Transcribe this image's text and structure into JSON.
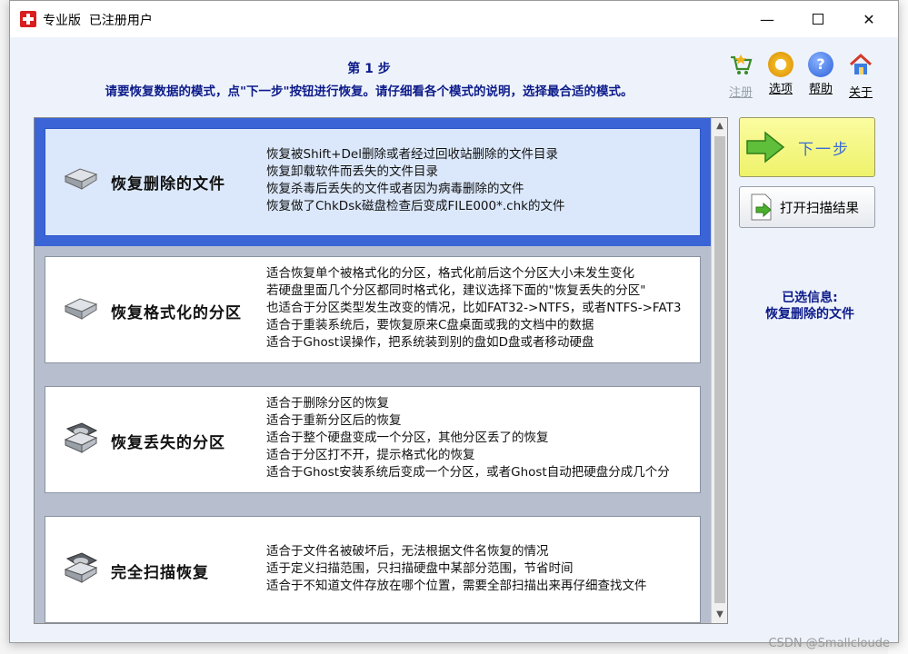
{
  "window": {
    "title": "专业版  已注册用户",
    "minimize": "—",
    "close": "✕"
  },
  "step": {
    "title": "第 1 步",
    "description": "请要恢复数据的模式，点\"下一步\"按钮进行恢复。请仔细看各个模式的说明，选择最合适的模式。"
  },
  "toolbar": {
    "register": "注册",
    "options": "选项",
    "help": "帮助",
    "about": "关于"
  },
  "modes": [
    {
      "name": "恢复删除的文件",
      "selected": true,
      "icon": "hard-disk-icon",
      "lines": [
        "恢复被Shift+Del删除或者经过回收站删除的文件目录",
        "恢复卸载软件而丢失的文件目录",
        "恢复杀毒后丢失的文件或者因为病毒删除的文件",
        "恢复做了ChkDsk磁盘检查后变成FILE000*.chk的文件"
      ]
    },
    {
      "name": "恢复格式化的分区",
      "selected": false,
      "icon": "hard-disk-icon",
      "lines": [
        "适合恢复单个被格式化的分区，格式化前后这个分区大小未发生变化",
        "若硬盘里面几个分区都同时格式化，建议选择下面的\"恢复丢失的分区\"",
        "也适合于分区类型发生改变的情况，比如FAT32->NTFS，或者NTFS->FAT3",
        "适合于重装系统后，要恢复原来C盘桌面或我的文档中的数据",
        "适合于Ghost误操作，把系统装到别的盘如D盘或者移动硬盘"
      ]
    },
    {
      "name": "恢复丢失的分区",
      "selected": false,
      "icon": "open-hard-disk-icon",
      "lines": [
        "适合于删除分区的恢复",
        "适合于重新分区后的恢复",
        "适合于整个硬盘变成一个分区，其他分区丢了的恢复",
        "适合于分区打不开，提示格式化的恢复",
        "适合于Ghost安装系统后变成一个分区，或者Ghost自动把硬盘分成几个分"
      ]
    },
    {
      "name": "完全扫描恢复",
      "selected": false,
      "icon": "open-hard-disk-icon",
      "lines": [
        "适合于文件名被破坏后，无法根据文件名恢复的情况",
        "适于定义扫描范围，只扫描硬盘中某部分范围，节省时间",
        "适合于不知道文件存放在哪个位置，需要全部扫描出来再仔细查找文件"
      ]
    }
  ],
  "buttons": {
    "next": "下一步",
    "open_scan": "打开扫描结果"
  },
  "selected_info": {
    "label": "已选信息:",
    "value": "恢复删除的文件"
  },
  "watermark": "CSDN @Smallcloude",
  "colors": {
    "accent_blue": "#0d1b8a",
    "selected_border": "#3b64d6",
    "next_button": "#eef26a"
  }
}
